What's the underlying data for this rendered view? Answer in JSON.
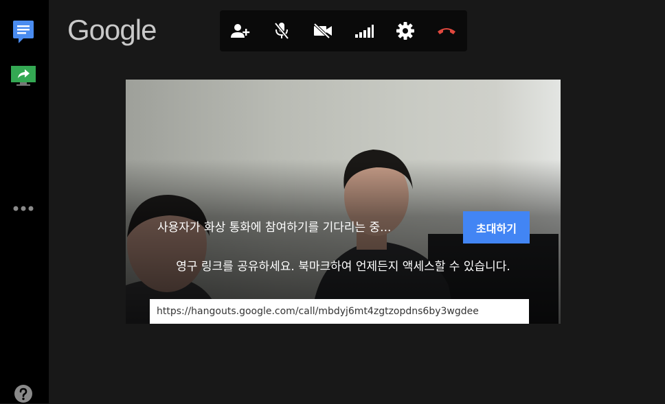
{
  "logo": {
    "text": "Google"
  },
  "toolbar": {
    "buttons": [
      {
        "icon": "add-person-icon"
      },
      {
        "icon": "mic-off-icon"
      },
      {
        "icon": "camera-off-icon"
      },
      {
        "icon": "signal-bars-icon"
      },
      {
        "icon": "gear-icon"
      },
      {
        "icon": "hang-up-icon",
        "color": "#e0483e"
      }
    ]
  },
  "sidebar": {
    "chat_icon": "chat-icon",
    "present_icon": "present-screen-icon",
    "more_icon": "more-dots-icon",
    "help_icon": "help-icon",
    "chat_color": "#4a8cf0",
    "present_color": "#34a853"
  },
  "call": {
    "waiting_text": "사용자가 화상 통화에 참여하기를 기다리는 중...",
    "invite_label": "초대하기",
    "share_text": "영구 링크를 공유하세요. 북마크하여 언제든지 액세스할 수 있습니다.",
    "link_value": "https://hangouts.google.com/call/mbdyj6mt4zgtzopdns6by3wgdee",
    "invite_color": "#4285f4"
  }
}
